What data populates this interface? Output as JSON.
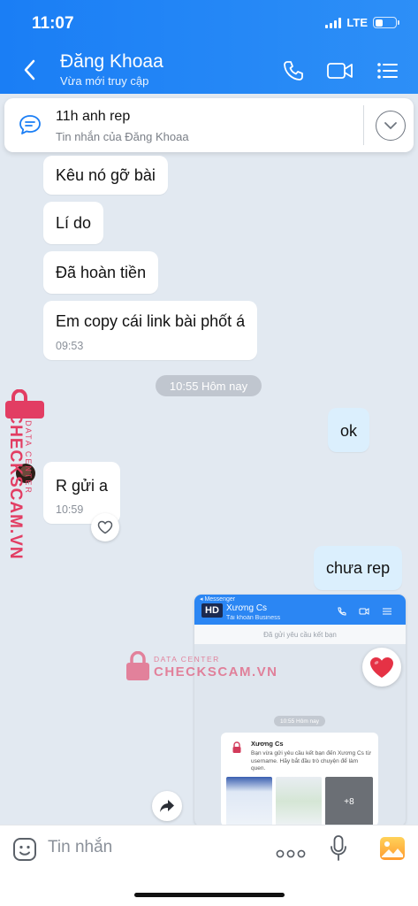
{
  "status_bar": {
    "time": "11:07",
    "network": "LTE",
    "battery_percent": 40
  },
  "header": {
    "contact_name": "Đăng Khoaa",
    "contact_status": "Vừa mới truy cập",
    "back_icon": "chevron-left-icon",
    "actions": [
      "phone-icon",
      "video-icon",
      "menu-list-icon"
    ]
  },
  "pinned": {
    "title": "11h anh rep",
    "subtitle": "Tin nhắn của Đăng Khoaa"
  },
  "messages": [
    {
      "from": "them",
      "text": "Kêu nó gỡ bài"
    },
    {
      "from": "them",
      "text": "Lí do"
    },
    {
      "from": "them",
      "text": "Đã hoàn tiền"
    },
    {
      "from": "them",
      "text": "Em copy cái link bài phốt á",
      "time": "09:53"
    },
    {
      "type": "separator",
      "text": "10:55 Hôm nay"
    },
    {
      "from": "me",
      "text": "ok"
    },
    {
      "from": "them",
      "text": "R gửi a",
      "time": "10:59"
    },
    {
      "from": "me",
      "text": "chưa rep"
    }
  ],
  "embedded_screenshot": {
    "app_label": "◂ Messenger",
    "badge": "HD",
    "name": "Xương Cs",
    "subtitle": "Tài khoản Business",
    "request_text": "Đã gửi yêu cầu kết bạn",
    "time_pill": "10:55 Hôm nay",
    "card_title": "Xương Cs",
    "card_body": "Bạn vừa gửi yêu cầu kết bạn đến Xương Cs từ username. Hãy bắt đầu trò chuyện để làm quen.",
    "more_count": "+8"
  },
  "reaction": "heart",
  "watermark": {
    "brand": "CHECKSCAM.VN",
    "tag": "DATA CENTER"
  },
  "composer": {
    "placeholder": "Tin nhắn",
    "more_label": "ooo"
  },
  "colors": {
    "header": "#1a7ef5",
    "background": "#e2e9f1",
    "my_bubble": "#dbeffd",
    "watermark": "#e23d63"
  }
}
